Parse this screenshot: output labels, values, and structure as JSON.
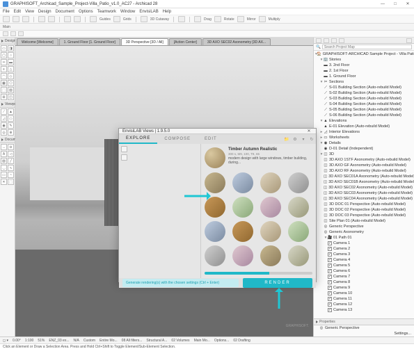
{
  "app": {
    "title": "GRAPHISOFT_Archicad_Sample_Project-Villa_Patio_v1.0_AC27 - Archicad 28",
    "brand": "GRAPHISOFT."
  },
  "menu": [
    "File",
    "Edit",
    "View",
    "Design",
    "Document",
    "Options",
    "Teamwork",
    "Window",
    "EnvisiLAB",
    "Help"
  ],
  "toolbar_labels": {
    "guides": "Guides",
    "grids": "Grids",
    "cutaway": "3D Cutaway",
    "drag": "Drag",
    "rotate": "Rotate",
    "mirror": "Mirror",
    "multiply": "Multiply"
  },
  "subbar": {
    "label": "Main"
  },
  "left": {
    "design": "Design",
    "viewpoint": "Viewpoint",
    "document": "Document"
  },
  "tabs": [
    {
      "label": "Welcome [Welcome]",
      "active": false
    },
    {
      "label": "1. Ground Floor [1. Ground Floor]",
      "active": false
    },
    {
      "label": "3D Perspective [3D / All]",
      "active": true
    },
    {
      "label": "[Action Center]",
      "active": false
    },
    {
      "label": "3D AXO SEC02 Axonometry [3D AX...",
      "active": false
    }
  ],
  "dialog": {
    "title": "EnvisiLAB Views | 1.9.5.0",
    "tabs": {
      "explore": "EXPLORE",
      "compose": "COMPOSE",
      "edit": "EDIT"
    },
    "card": {
      "title": "Timber Autumn Realistic",
      "sub": "300 s, M9, 100, T8, 65",
      "desc": "modern design with large windows, timber building, during..."
    },
    "hint": "Generate rendering(s) with the chosen settings (Ctrl + Enter)",
    "render": "RENDER"
  },
  "nav": {
    "search_placeholder": "Search Project Map",
    "root": "GRAPHISOFT-ARCHICAD Sample Project - Villa Patio",
    "stories": {
      "label": "Stories",
      "items": [
        "3. 2nd Floor",
        "2. 1st Floor",
        "1. Ground Floor"
      ]
    },
    "sections": {
      "label": "Sections",
      "items": [
        "S-01 Building Section (Auto-rebuild Model)",
        "S-02 Building Section (Auto-rebuild Model)",
        "S-03 Building Section (Auto-rebuild Model)",
        "S-04 Building Section (Auto-rebuild Model)",
        "S-05 Building Section (Auto-rebuild Model)",
        "S-06 Building Section (Auto-rebuild Model)"
      ]
    },
    "elevations": {
      "label": "Elevations",
      "items": [
        "E-01 Elevation (Auto-rebuild Model)"
      ]
    },
    "interior": "Interior Elevations",
    "worksheets": "Worksheets",
    "details": {
      "label": "Details",
      "item": "D-01 Detail (Independent)"
    },
    "threeD": {
      "label": "3D",
      "items": [
        "3D AXO 1STF Axonometry (Auto-rebuild Model)",
        "3D AXO GF Axonometry (Auto-rebuild Model)",
        "3D AXO RF Axonometry (Auto-rebuild Model)",
        "3D AXO SEC01A Axonometry (Auto-rebuild Model)",
        "3D AXO SEC01B Axonometry (Auto-rebuild Model)",
        "3D AXO SEC02 Axonometry (Auto-rebuild Model)",
        "3D AXO SEC03 Axonometry (Auto-rebuild Model)",
        "3D AXO SEC04 Axonometry (Auto-rebuild Model)",
        "3D DOC 01 Perspective (Auto-rebuild Model)",
        "3D DOC 02 Perspective (Auto-rebuild Model)",
        "3D DOC 03 Perspective (Auto-rebuild Model)",
        "Site Plan 01 (Auto-rebuild Model)"
      ]
    },
    "generic_persp": "Generic Perspective",
    "generic_axo": "Generic Axonometry",
    "path": {
      "label": "01 Path 01",
      "cams": [
        "Camera 1",
        "Camera 2",
        "Camera 3",
        "Camera 4",
        "Camera 5",
        "Camera 6",
        "Camera 7",
        "Camera 8",
        "Camera 9",
        "Camera 10",
        "Camera 11",
        "Camera 12",
        "Camera 13"
      ]
    },
    "properties": "Properties",
    "current": "Generic Perspective",
    "settings": "Settings..."
  },
  "status": {
    "coord": "0.00°",
    "scale": "1:100",
    "zoom": "51%",
    "opt": "ENZ_03 ex...",
    "na": "N/A",
    "custom": "Custom",
    "entire": "Entire Mo...",
    "filters": "08 All filters...",
    "structural": "Structural A...",
    "vol": "02 Volumes",
    "mainm": "Main Mo...",
    "options": "Options...",
    "complete": "02 Drafting"
  },
  "hint": "Click an Element or Draw a Selection Area. Press and Hold Ctrl+Shift to Toggle Element/Sub-Element Selection."
}
